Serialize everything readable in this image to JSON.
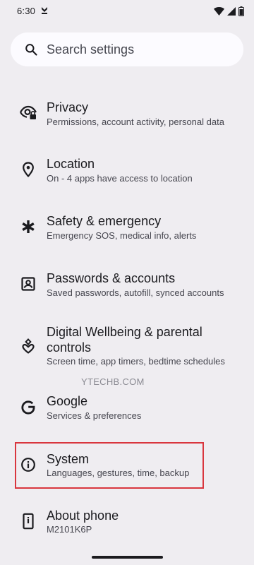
{
  "status_bar": {
    "time": "6:30",
    "notification_icon": "download-icon",
    "icons": [
      "wifi-icon",
      "cell-signal-icon",
      "battery-icon"
    ]
  },
  "search": {
    "placeholder": "Search settings",
    "icon": "search-icon"
  },
  "settings": [
    {
      "icon": "privacy-eye-icon",
      "title": "Privacy",
      "subtitle": "Permissions, account activity, personal data"
    },
    {
      "icon": "location-pin-icon",
      "title": "Location",
      "subtitle": "On - 4 apps have access to location"
    },
    {
      "icon": "asterisk-icon",
      "title": "Safety & emergency",
      "subtitle": "Emergency SOS, medical info, alerts"
    },
    {
      "icon": "account-box-icon",
      "title": "Passwords & accounts",
      "subtitle": "Saved passwords, autofill, synced accounts"
    },
    {
      "icon": "wellbeing-icon",
      "title": "Digital Wellbeing & parental controls",
      "subtitle": "Screen time, app timers, bedtime schedules"
    },
    {
      "icon": "google-g-icon",
      "title": "Google",
      "subtitle": "Services & preferences"
    },
    {
      "icon": "info-icon",
      "title": "System",
      "subtitle": "Languages, gestures, time, backup"
    },
    {
      "icon": "phone-icon",
      "title": "About phone",
      "subtitle": "M2101K6P"
    }
  ],
  "watermark": "YTECHB.COM",
  "colors": {
    "background": "#efedf1",
    "search_background": "#fcfbff",
    "highlight": "#d9363e",
    "text_primary": "#1b1b1f",
    "text_secondary": "#46464f"
  }
}
